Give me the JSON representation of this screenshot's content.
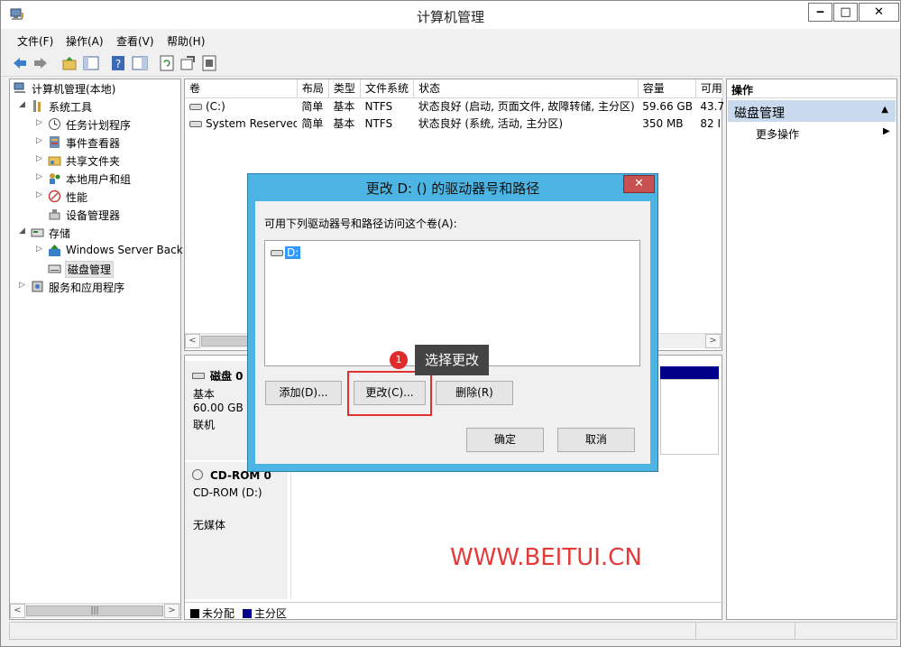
{
  "window": {
    "title": "计算机管理",
    "min": "‒",
    "max": "□",
    "close": "✕"
  },
  "menu": [
    "文件(F)",
    "操作(A)",
    "查看(V)",
    "帮助(H)"
  ],
  "tree": {
    "root": "计算机管理(本地)",
    "items": [
      {
        "label": "系统工具",
        "icon": "tools-icon"
      },
      {
        "label": "任务计划程序",
        "icon": "clock-icon"
      },
      {
        "label": "事件查看器",
        "icon": "event-viewer-icon"
      },
      {
        "label": "共享文件夹",
        "icon": "shared-folder-icon"
      },
      {
        "label": "本地用户和组",
        "icon": "users-icon"
      },
      {
        "label": "性能",
        "icon": "performance-icon"
      },
      {
        "label": "设备管理器",
        "icon": "device-manager-icon"
      },
      {
        "label": "存储",
        "icon": "storage-icon"
      },
      {
        "label": "Windows Server Back",
        "icon": "backup-icon"
      },
      {
        "label": "磁盘管理",
        "icon": "disk-management-icon"
      },
      {
        "label": "服务和应用程序",
        "icon": "services-icon"
      }
    ]
  },
  "volumes": {
    "headers": [
      "卷",
      "布局",
      "类型",
      "文件系统",
      "状态",
      "容量",
      "可用"
    ],
    "rows": [
      [
        "(C:)",
        "简单",
        "基本",
        "NTFS",
        "状态良好 (启动, 页面文件, 故障转储, 主分区)",
        "59.66 GB",
        "43.7"
      ],
      [
        "System Reserved",
        "简单",
        "基本",
        "NTFS",
        "状态良好 (系统, 活动, 主分区)",
        "350 MB",
        "82 I"
      ]
    ]
  },
  "disk0": {
    "name": "磁盘 0",
    "type": "基本",
    "size": "60.00 GB",
    "status": "联机"
  },
  "cdrom": {
    "name": "CD-ROM 0",
    "drive": "CD-ROM (D:)",
    "media": "无媒体"
  },
  "legend": {
    "unallocated": "未分配",
    "primary": "主分区",
    "unallocated_color": "#000000",
    "primary_color": "#00008b"
  },
  "actions": {
    "header": "操作",
    "group": "磁盘管理",
    "more": "更多操作"
  },
  "dialog": {
    "title": "更改 D: () 的驱动器号和路径",
    "close": "✕",
    "prompt": "可用下列驱动器号和路径访问这个卷(A):",
    "list_item": "D:",
    "add": "添加(D)...",
    "change": "更改(C)...",
    "remove": "删除(R)",
    "ok": "确定",
    "cancel": "取消"
  },
  "annotation": {
    "step": "1",
    "tip": "选择更改",
    "accent": "#e02b2b"
  },
  "watermark": "WWW.BEITUI.CN"
}
